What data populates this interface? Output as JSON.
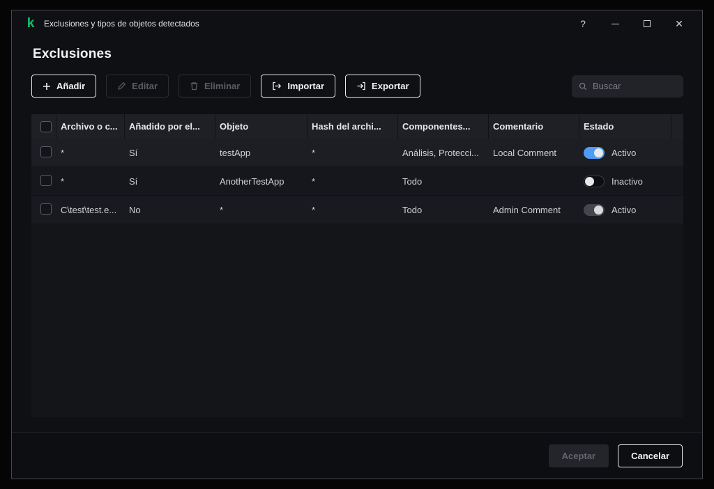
{
  "window": {
    "title": "Exclusiones y tipos de objetos detectados",
    "controls": {
      "help": "?",
      "close": "✕"
    }
  },
  "page": {
    "title": "Exclusiones"
  },
  "toolbar": {
    "add_label": "Añadir",
    "edit_label": "Editar",
    "delete_label": "Eliminar",
    "import_label": "Importar",
    "export_label": "Exportar",
    "search_placeholder": "Buscar"
  },
  "table": {
    "columns": {
      "file": "Archivo o c...",
      "added_by": "Añadido por el...",
      "object": "Objeto",
      "hash": "Hash del archi...",
      "components": "Componentes...",
      "comment": "Comentario",
      "state": "Estado"
    },
    "rows": [
      {
        "file": "*",
        "added_by": "Sí",
        "object": "testApp",
        "hash": "*",
        "components": "Análisis, Protecci...",
        "comment": "Local Comment",
        "state_label": "Activo",
        "state_on": true,
        "toggle_style": "blue"
      },
      {
        "file": "*",
        "added_by": "Sí",
        "object": "AnotherTestApp",
        "hash": "*",
        "components": "Todo",
        "comment": "",
        "state_label": "Inactivo",
        "state_on": false,
        "toggle_style": "off"
      },
      {
        "file": "C\\test\\test.e...",
        "added_by": "No",
        "object": "*",
        "hash": "*",
        "components": "Todo",
        "comment": "Admin Comment",
        "state_label": "Activo",
        "state_on": true,
        "toggle_style": "grey"
      }
    ]
  },
  "footer": {
    "accept_label": "Aceptar",
    "cancel_label": "Cancelar"
  },
  "colors": {
    "accent_toggle_on": "#4e9cf6",
    "brand_green": "#0cc16e"
  }
}
